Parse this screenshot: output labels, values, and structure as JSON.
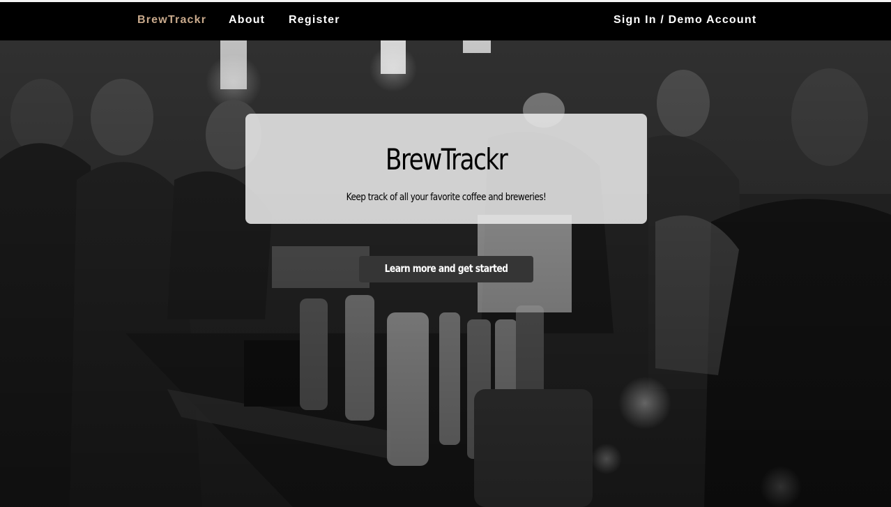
{
  "navbar": {
    "brand": "BrewTrackr",
    "links": [
      {
        "label": "About"
      },
      {
        "label": "Register"
      }
    ],
    "signin": "Sign In / Demo Account"
  },
  "hero": {
    "background_description": "black and white photo of a crowded bar",
    "title": "BrewTrackr",
    "subtitle": "Keep track of all your favorite coffee and breweries!",
    "cta_label": "Learn more and get started"
  },
  "colors": {
    "nav_background": "#000000",
    "brand_accent": "#c9aa8c",
    "nav_text": "#ffffff",
    "jumbotron_background": "#e8e8e8",
    "cta_background": "#353535",
    "cta_text": "#ffffff"
  }
}
